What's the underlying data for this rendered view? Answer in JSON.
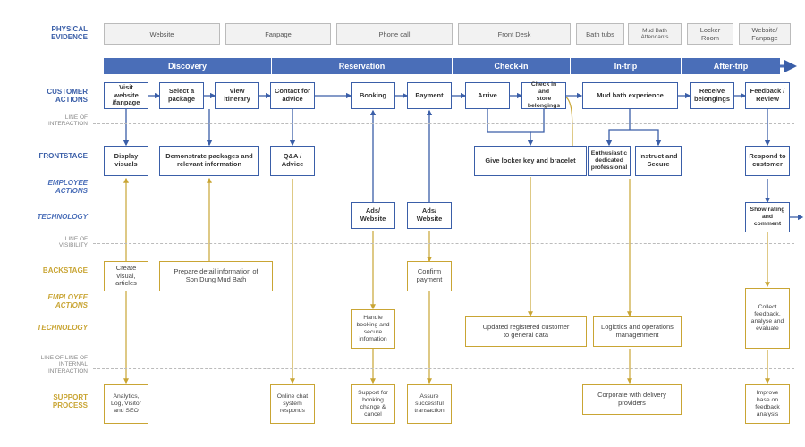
{
  "labels": {
    "physical_evidence": "PHYSICAL\nEVIDENCE",
    "customer_actions": "CUSTOMER\nACTIONS",
    "line_interaction": "LINE OF\nINTERACTION",
    "frontstage": "FRONTSTAGE",
    "fs_employee_actions": "EMPLOYEE\nACTIONS",
    "fs_technology": "TECHNOLOGY",
    "line_visibility": "LINE OF\nVISIBILITY",
    "backstage": "BACKSTAGE",
    "bs_employee_actions": "EMPLOYEE\nACTIONS",
    "bs_technology": "TECHNOLOGY",
    "line_internal": "LINE OF LINE OF\nINTERNAL\nINTERACTION",
    "support_process": "SUPPORT\nPROCESS"
  },
  "physical_evidence": {
    "website": "Website",
    "fanpage": "Fanpage",
    "phone_call": "Phone call",
    "front_desk": "Front Desk",
    "bath_tubs": "Bath tubs",
    "attendants": "Mud Bath\nAttendants",
    "locker_room": "Locker\nRoom",
    "website_fanpage": "Website/\nFanpage"
  },
  "phases": {
    "discovery": "Discovery",
    "reservation": "Reservation",
    "check_in": "Check-in",
    "in_trip": "In-trip",
    "after_trip": "After-trip"
  },
  "customer_actions": {
    "visit": "Visit website\n/fanpage",
    "select": "Select a\npackage",
    "view": "View\nitinerary",
    "contact": "Contact for\nadvice",
    "booking": "Booking",
    "payment": "Payment",
    "arrive": "Arrive",
    "check_store": "Check in and\nstore\nbelongings",
    "mudbath": "Mud bath experience",
    "receive": "Receive\nbelongings",
    "feedback": "Feedback /\nReview"
  },
  "frontstage_emp": {
    "display": "Display\nvisuals",
    "demonstrate": "Demonstrate packages and\nrelevant information",
    "qa": "Q&A /\nAdvice",
    "locker": "Give locker key and bracelet",
    "enthusiastic": "Enthusiastic\ndedicated\nprofessional",
    "instruct": "Instruct and\nSecure",
    "respond": "Respond to\ncustomer"
  },
  "frontstage_tech": {
    "ads1": "Ads/\nWebsite",
    "ads2": "Ads/\nWebsite",
    "show_rating": "Show rating\nand\ncomment"
  },
  "backstage_emp": {
    "create": "Create visual,\narticles",
    "prepare": "Prepare detail information of\nSon Dung Mud Bath",
    "confirm": "Confirm\npayment"
  },
  "backstage_tech": {
    "handle": "Handle\nbooking and\nsecure\ninfomation",
    "update": "Updated registered customer\nto general data",
    "logistics": "Logictics and operations\nmanagenment",
    "collect": "Collect\nfeedback,\nanalyse and\nevaluate"
  },
  "support": {
    "analytics": "Analytics,\nLog, Visitor\nand SEO",
    "chat": "Online chat\nsystem\nresponds",
    "booking_change": "Support for\nbooking\nchange &\ncancel",
    "transaction": "Assure\nsuccessful\ntransaction",
    "corporate": "Corporate with delivery\nproviders",
    "improve": "Improve\nbase on\nfeedback\nanalysis"
  }
}
